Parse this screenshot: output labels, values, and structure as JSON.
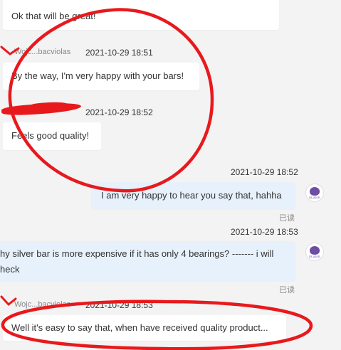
{
  "messages": [
    {
      "text": "Ok that will be great!"
    },
    {
      "sender": "Wojc...bacviolas",
      "time": "2021-10-29 18:51",
      "text": "By the way, I'm very happy with your bars!"
    },
    {
      "sender": "",
      "time": "2021-10-29 18:52",
      "text": "Feels good quality!"
    },
    {
      "time": "2021-10-29 18:52",
      "text": "I am very happy to hear you say that, hahha",
      "status": "已读"
    },
    {
      "time": "2021-10-29 18:53",
      "text_line1": "hy silver bar is more expensive if it has only 4 bearings? ------- i will",
      "text_line2": "heck",
      "status": "已读"
    },
    {
      "sender": "Wojc...bacviolas",
      "time": "2021-10-29 18:53",
      "text": "Well it's easy to say that, when have received quality product..."
    }
  ],
  "avatar": {
    "brand_text": "ELAISE"
  },
  "colors": {
    "background": "#f3f3f3",
    "incoming_bubble": "#ffffff",
    "outgoing_bubble": "#e6f1fb",
    "annotation_red": "#e8191c",
    "avatar_purple": "#6d4ea3"
  }
}
